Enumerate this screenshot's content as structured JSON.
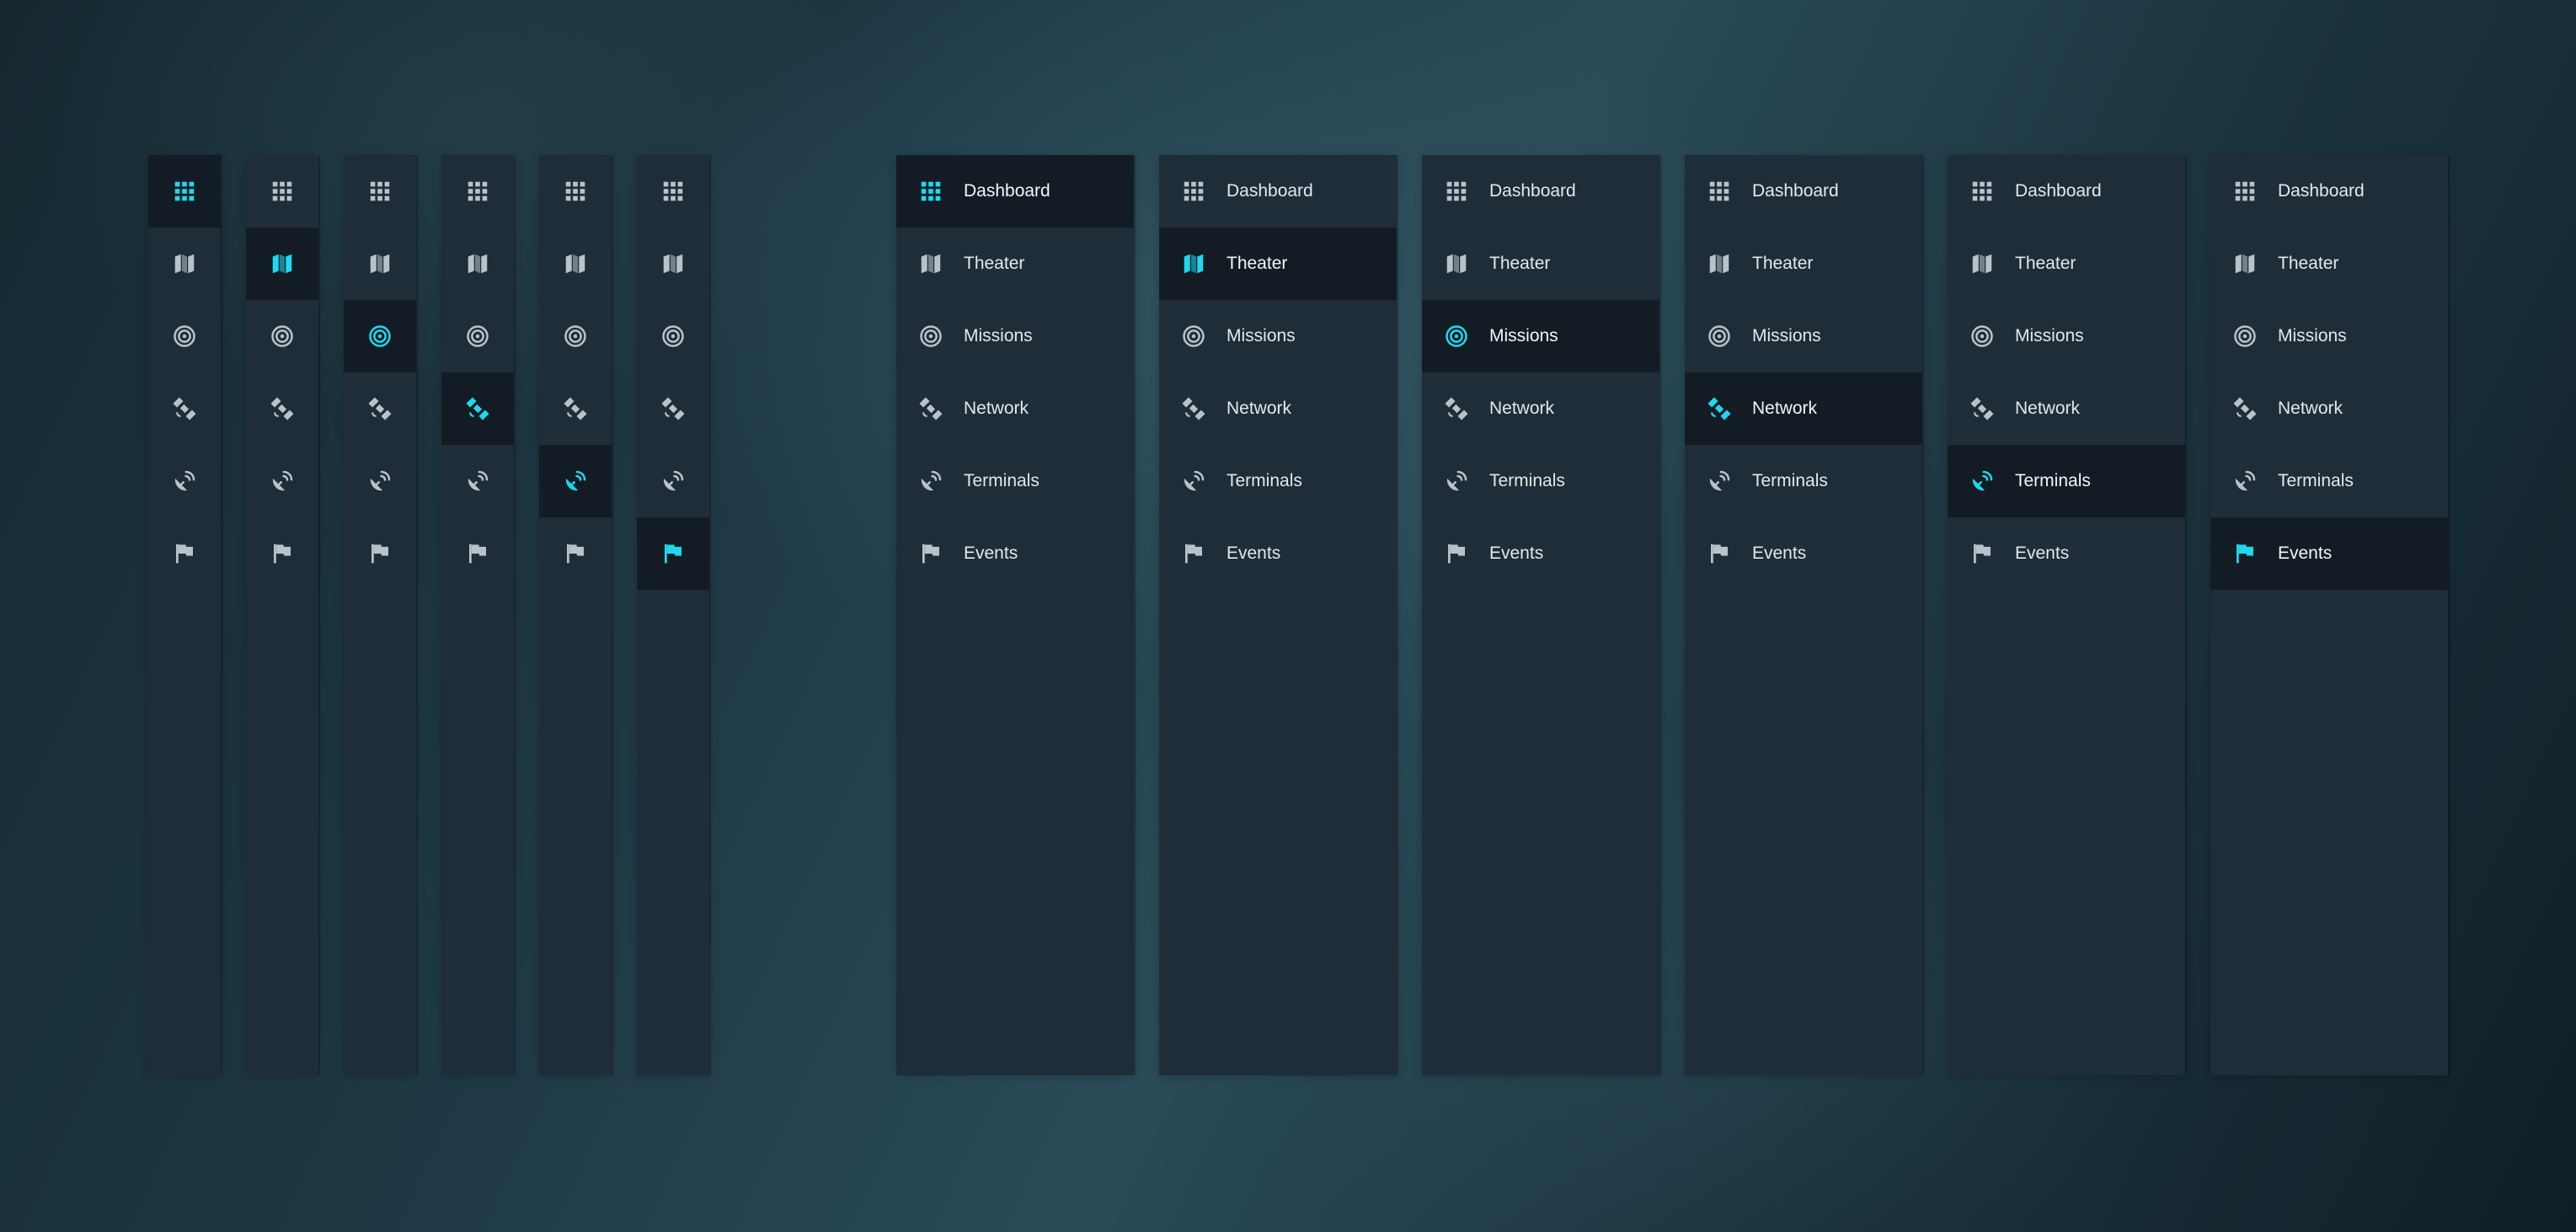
{
  "colors": {
    "accent": "#1fd8ee",
    "icon_default": "#b9c2ca",
    "sidebar_background": "#1f2d39",
    "active_item_background": "#131c24",
    "label_text": "#e3e8ec"
  },
  "nav": {
    "items": [
      {
        "id": "dashboard",
        "label": "Dashboard",
        "icon": "grid-icon"
      },
      {
        "id": "theater",
        "label": "Theater",
        "icon": "map-icon"
      },
      {
        "id": "missions",
        "label": "Missions",
        "icon": "target-icon"
      },
      {
        "id": "network",
        "label": "Network",
        "icon": "satellite-icon"
      },
      {
        "id": "terminals",
        "label": "Terminals",
        "icon": "satellite-dish-icon"
      },
      {
        "id": "events",
        "label": "Events",
        "icon": "flag-icon"
      }
    ]
  },
  "collapsed_variants": [
    {
      "active": "dashboard"
    },
    {
      "active": "theater"
    },
    {
      "active": "missions"
    },
    {
      "active": "network"
    },
    {
      "active": "terminals"
    },
    {
      "active": "events"
    }
  ],
  "expanded_variants": [
    {
      "active": "dashboard"
    },
    {
      "active": "theater"
    },
    {
      "active": "missions"
    },
    {
      "active": "network"
    },
    {
      "active": "terminals"
    },
    {
      "active": "events"
    }
  ]
}
